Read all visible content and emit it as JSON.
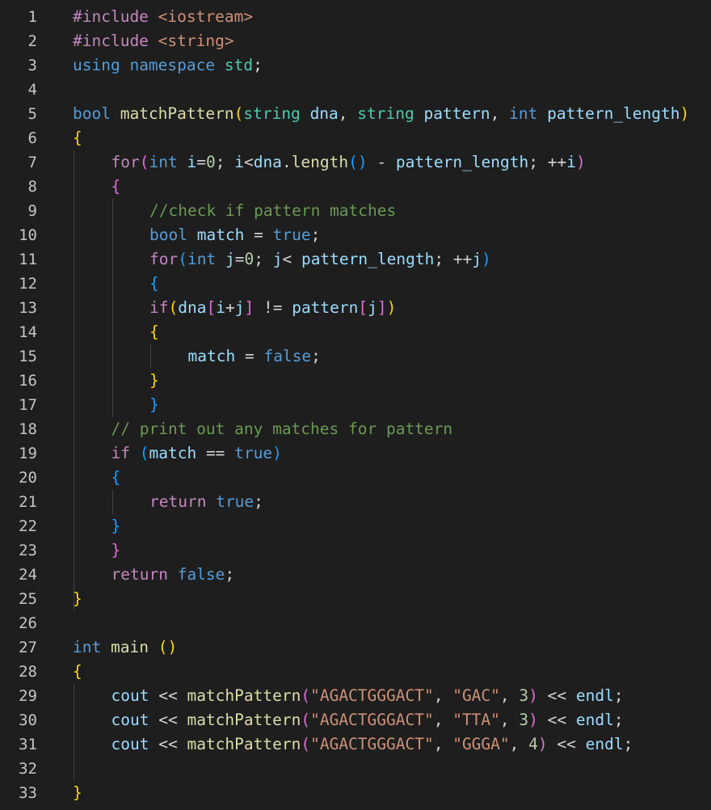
{
  "editor": {
    "language": "cpp",
    "colors": {
      "background": "#1e1e1e",
      "keyword": "#569cd6",
      "control": "#c586c0",
      "function": "#dcdcaa",
      "variable": "#9cdcfe",
      "type": "#4ec9b0",
      "string": "#ce9178",
      "number": "#b5cea8",
      "comment": "#6a9955",
      "bracket_level1": "#ffd700",
      "bracket_level2": "#da70d6",
      "bracket_level3": "#179fff"
    },
    "lines": [
      {
        "n": "1",
        "indent": 0,
        "tokens": [
          [
            "ctl",
            "#include "
          ],
          [
            "str",
            "<iostream>"
          ]
        ]
      },
      {
        "n": "2",
        "indent": 0,
        "tokens": [
          [
            "ctl",
            "#include "
          ],
          [
            "str",
            "<string>"
          ]
        ]
      },
      {
        "n": "3",
        "indent": 0,
        "tokens": [
          [
            "kw",
            "using"
          ],
          [
            "plain",
            " "
          ],
          [
            "kw",
            "namespace"
          ],
          [
            "plain",
            " "
          ],
          [
            "type",
            "std"
          ],
          [
            "plain",
            ";"
          ]
        ]
      },
      {
        "n": "4",
        "indent": 0,
        "tokens": []
      },
      {
        "n": "5",
        "indent": 0,
        "tokens": [
          [
            "kw",
            "bool"
          ],
          [
            "plain",
            " "
          ],
          [
            "fn",
            "matchPattern"
          ],
          [
            "b1",
            "("
          ],
          [
            "type",
            "string"
          ],
          [
            "plain",
            " "
          ],
          [
            "var",
            "dna"
          ],
          [
            "plain",
            ", "
          ],
          [
            "type",
            "string"
          ],
          [
            "plain",
            " "
          ],
          [
            "var",
            "pattern"
          ],
          [
            "plain",
            ", "
          ],
          [
            "kw",
            "int"
          ],
          [
            "plain",
            " "
          ],
          [
            "var",
            "pattern_length"
          ],
          [
            "b1",
            ")"
          ]
        ]
      },
      {
        "n": "6",
        "indent": 0,
        "tokens": [
          [
            "b1",
            "{"
          ]
        ]
      },
      {
        "n": "7",
        "indent": 1,
        "tokens": [
          [
            "ctl",
            "for"
          ],
          [
            "b2",
            "("
          ],
          [
            "kw",
            "int"
          ],
          [
            "plain",
            " "
          ],
          [
            "var",
            "i"
          ],
          [
            "op",
            "="
          ],
          [
            "num",
            "0"
          ],
          [
            "plain",
            "; "
          ],
          [
            "var",
            "i"
          ],
          [
            "op",
            "<"
          ],
          [
            "var",
            "dna"
          ],
          [
            "plain",
            "."
          ],
          [
            "fn",
            "length"
          ],
          [
            "b3",
            "()"
          ],
          [
            "plain",
            " "
          ],
          [
            "op",
            "-"
          ],
          [
            "plain",
            " "
          ],
          [
            "var",
            "pattern_length"
          ],
          [
            "plain",
            "; "
          ],
          [
            "op",
            "++"
          ],
          [
            "var",
            "i"
          ],
          [
            "b2",
            ")"
          ]
        ]
      },
      {
        "n": "8",
        "indent": 1,
        "tokens": [
          [
            "b2",
            "{"
          ]
        ]
      },
      {
        "n": "9",
        "indent": 2,
        "tokens": [
          [
            "com",
            "//check if pattern matches"
          ]
        ]
      },
      {
        "n": "10",
        "indent": 2,
        "tokens": [
          [
            "kw",
            "bool"
          ],
          [
            "plain",
            " "
          ],
          [
            "var",
            "match"
          ],
          [
            "plain",
            " "
          ],
          [
            "op",
            "="
          ],
          [
            "plain",
            " "
          ],
          [
            "kw",
            "true"
          ],
          [
            "plain",
            ";"
          ]
        ]
      },
      {
        "n": "11",
        "indent": 2,
        "tokens": [
          [
            "ctl",
            "for"
          ],
          [
            "b3",
            "("
          ],
          [
            "kw",
            "int"
          ],
          [
            "plain",
            " "
          ],
          [
            "var",
            "j"
          ],
          [
            "op",
            "="
          ],
          [
            "num",
            "0"
          ],
          [
            "plain",
            "; "
          ],
          [
            "var",
            "j"
          ],
          [
            "op",
            "<"
          ],
          [
            "plain",
            " "
          ],
          [
            "var",
            "pattern_length"
          ],
          [
            "plain",
            "; "
          ],
          [
            "op",
            "++"
          ],
          [
            "var",
            "j"
          ],
          [
            "b3",
            ")"
          ]
        ]
      },
      {
        "n": "12",
        "indent": 2,
        "tokens": [
          [
            "b3",
            "{"
          ]
        ]
      },
      {
        "n": "13",
        "indent": 2,
        "tokens": [
          [
            "ctl",
            "if"
          ],
          [
            "b1",
            "("
          ],
          [
            "var",
            "dna"
          ],
          [
            "b2",
            "["
          ],
          [
            "var",
            "i"
          ],
          [
            "op",
            "+"
          ],
          [
            "var",
            "j"
          ],
          [
            "b2",
            "]"
          ],
          [
            "plain",
            " "
          ],
          [
            "op",
            "!="
          ],
          [
            "plain",
            " "
          ],
          [
            "var",
            "pattern"
          ],
          [
            "b2",
            "["
          ],
          [
            "var",
            "j"
          ],
          [
            "b2",
            "]"
          ],
          [
            "b1",
            ")"
          ]
        ]
      },
      {
        "n": "14",
        "indent": 2,
        "tokens": [
          [
            "b1",
            "{"
          ]
        ]
      },
      {
        "n": "15",
        "indent": 3,
        "tokens": [
          [
            "var",
            "match"
          ],
          [
            "plain",
            " "
          ],
          [
            "op",
            "="
          ],
          [
            "plain",
            " "
          ],
          [
            "kw",
            "false"
          ],
          [
            "plain",
            ";"
          ]
        ]
      },
      {
        "n": "16",
        "indent": 2,
        "tokens": [
          [
            "b1",
            "}"
          ]
        ]
      },
      {
        "n": "17",
        "indent": 2,
        "tokens": [
          [
            "b3",
            "}"
          ]
        ]
      },
      {
        "n": "18",
        "indent": 1,
        "tokens": [
          [
            "com",
            "// print out any matches for pattern"
          ]
        ]
      },
      {
        "n": "19",
        "indent": 1,
        "tokens": [
          [
            "ctl",
            "if"
          ],
          [
            "plain",
            " "
          ],
          [
            "b3",
            "("
          ],
          [
            "var",
            "match"
          ],
          [
            "plain",
            " "
          ],
          [
            "op",
            "=="
          ],
          [
            "plain",
            " "
          ],
          [
            "kw",
            "true"
          ],
          [
            "b3",
            ")"
          ]
        ]
      },
      {
        "n": "20",
        "indent": 1,
        "tokens": [
          [
            "b3",
            "{"
          ]
        ]
      },
      {
        "n": "21",
        "indent": 2,
        "tokens": [
          [
            "ctl",
            "return"
          ],
          [
            "plain",
            " "
          ],
          [
            "kw",
            "true"
          ],
          [
            "plain",
            ";"
          ]
        ]
      },
      {
        "n": "22",
        "indent": 1,
        "tokens": [
          [
            "b3",
            "}"
          ]
        ]
      },
      {
        "n": "23",
        "indent": 1,
        "tokens": [
          [
            "b2",
            "}"
          ]
        ]
      },
      {
        "n": "24",
        "indent": 1,
        "tokens": [
          [
            "ctl",
            "return"
          ],
          [
            "plain",
            " "
          ],
          [
            "kw",
            "false"
          ],
          [
            "plain",
            ";"
          ]
        ]
      },
      {
        "n": "25",
        "indent": 0,
        "tokens": [
          [
            "b1",
            "}"
          ]
        ]
      },
      {
        "n": "26",
        "indent": 0,
        "tokens": []
      },
      {
        "n": "27",
        "indent": 0,
        "tokens": [
          [
            "kw",
            "int"
          ],
          [
            "plain",
            " "
          ],
          [
            "fn",
            "main"
          ],
          [
            "plain",
            " "
          ],
          [
            "b1",
            "()"
          ]
        ]
      },
      {
        "n": "28",
        "indent": 0,
        "tokens": [
          [
            "b1",
            "{"
          ]
        ]
      },
      {
        "n": "29",
        "indent": 1,
        "tokens": [
          [
            "var",
            "cout"
          ],
          [
            "plain",
            " "
          ],
          [
            "op",
            "<<"
          ],
          [
            "plain",
            " "
          ],
          [
            "fn",
            "matchPattern"
          ],
          [
            "b2",
            "("
          ],
          [
            "str",
            "\"AGACTGGGACT\""
          ],
          [
            "plain",
            ", "
          ],
          [
            "str",
            "\"GAC\""
          ],
          [
            "plain",
            ", "
          ],
          [
            "num",
            "3"
          ],
          [
            "b2",
            ")"
          ],
          [
            "plain",
            " "
          ],
          [
            "op",
            "<<"
          ],
          [
            "plain",
            " "
          ],
          [
            "var",
            "endl"
          ],
          [
            "plain",
            ";"
          ]
        ]
      },
      {
        "n": "30",
        "indent": 1,
        "tokens": [
          [
            "var",
            "cout"
          ],
          [
            "plain",
            " "
          ],
          [
            "op",
            "<<"
          ],
          [
            "plain",
            " "
          ],
          [
            "fn",
            "matchPattern"
          ],
          [
            "b2",
            "("
          ],
          [
            "str",
            "\"AGACTGGGACT\""
          ],
          [
            "plain",
            ", "
          ],
          [
            "str",
            "\"TTA\""
          ],
          [
            "plain",
            ", "
          ],
          [
            "num",
            "3"
          ],
          [
            "b2",
            ")"
          ],
          [
            "plain",
            " "
          ],
          [
            "op",
            "<<"
          ],
          [
            "plain",
            " "
          ],
          [
            "var",
            "endl"
          ],
          [
            "plain",
            ";"
          ]
        ]
      },
      {
        "n": "31",
        "indent": 1,
        "tokens": [
          [
            "var",
            "cout"
          ],
          [
            "plain",
            " "
          ],
          [
            "op",
            "<<"
          ],
          [
            "plain",
            " "
          ],
          [
            "fn",
            "matchPattern"
          ],
          [
            "b2",
            "("
          ],
          [
            "str",
            "\"AGACTGGGACT\""
          ],
          [
            "plain",
            ", "
          ],
          [
            "str",
            "\"GGGA\""
          ],
          [
            "plain",
            ", "
          ],
          [
            "num",
            "4"
          ],
          [
            "b2",
            ")"
          ],
          [
            "plain",
            " "
          ],
          [
            "op",
            "<<"
          ],
          [
            "plain",
            " "
          ],
          [
            "var",
            "endl"
          ],
          [
            "plain",
            ";"
          ]
        ]
      },
      {
        "n": "32",
        "indent": 0,
        "tokens": []
      },
      {
        "n": "33",
        "indent": 0,
        "tokens": [
          [
            "b1",
            "}"
          ]
        ]
      }
    ]
  }
}
